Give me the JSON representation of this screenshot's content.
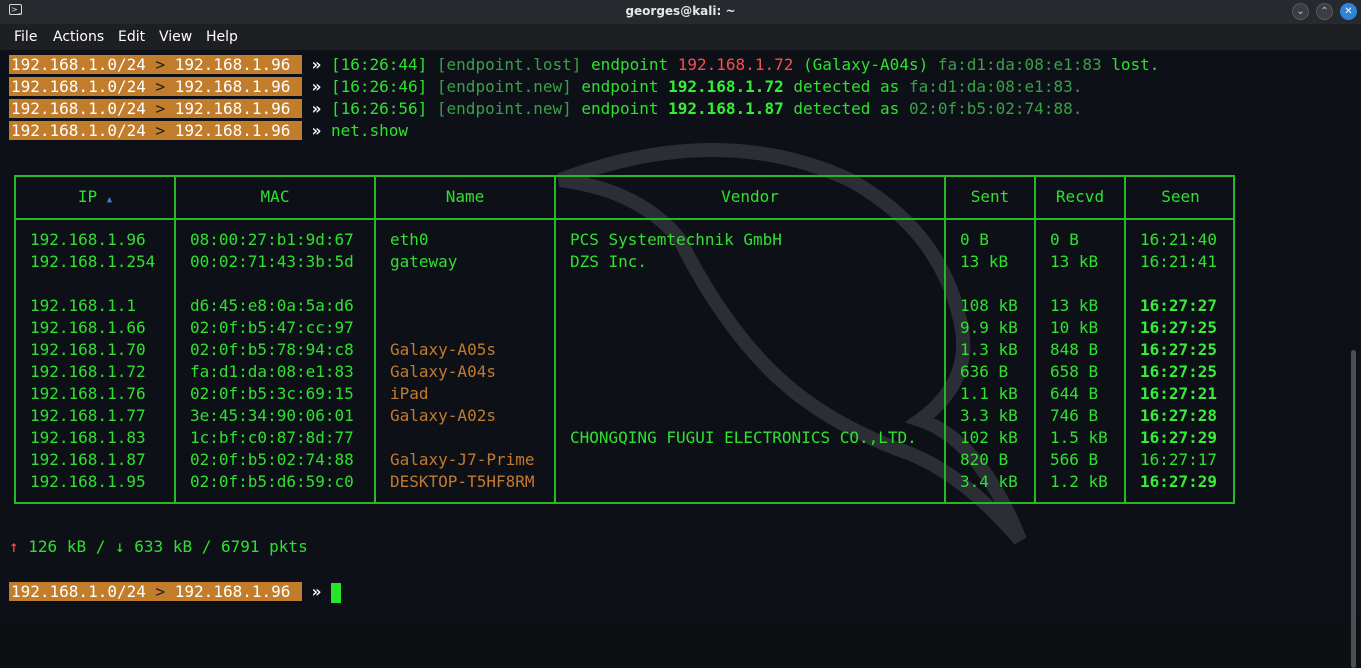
{
  "window": {
    "title": "georges@kali: ~",
    "buttons": [
      "⌄",
      "⌃",
      "✕"
    ]
  },
  "menu": [
    "File",
    "Actions",
    "Edit",
    "View",
    "Help"
  ],
  "prompt": {
    "subnet": "192.168.1.0/24",
    "sep": ">",
    "ip": "192.168.1.96",
    "arrow": "»"
  },
  "log": [
    {
      "time": "[16:26:44]",
      "tag": "[endpoint.lost]",
      "text1": "endpoint",
      "ip": "192.168.1.72",
      "extra": "(Galaxy-A04s)",
      "mac": "fa:d1:da:08:e1:83",
      "end": "lost."
    },
    {
      "time": "[16:26:46]",
      "tag": "[endpoint.new]",
      "text1": "endpoint",
      "ip": "192.168.1.72",
      "extra": "detected as",
      "mac": "fa:d1:da:08:e1:83",
      "end": "."
    },
    {
      "time": "[16:26:56]",
      "tag": "[endpoint.new]",
      "text1": "endpoint",
      "ip": "192.168.1.87",
      "extra": "detected as",
      "mac": "02:0f:b5:02:74:88",
      "end": "."
    }
  ],
  "command": "net.show",
  "table": {
    "headers": [
      "IP",
      "MAC",
      "Name",
      "Vendor",
      "Sent",
      "Recvd",
      "Seen"
    ],
    "sort_indicator": "▲",
    "rows": [
      {
        "ip": "192.168.1.96",
        "mac": "08:00:27:b1:9d:67",
        "name": "eth0",
        "vendor": "PCS Systemtechnik GmbH",
        "sent": "0 B",
        "recvd": "0 B",
        "seen": "16:21:40",
        "seen_bold": false,
        "name_color": "green"
      },
      {
        "ip": "192.168.1.254",
        "mac": "00:02:71:43:3b:5d",
        "name": "gateway",
        "vendor": "DZS Inc.",
        "sent": "13 kB",
        "recvd": "13 kB",
        "seen": "16:21:41",
        "seen_bold": false,
        "name_color": "green"
      },
      {
        "ip": "192.168.1.1",
        "mac": "d6:45:e8:0a:5a:d6",
        "name": "",
        "vendor": "",
        "sent": "108 kB",
        "recvd": "13 kB",
        "seen": "16:27:27",
        "seen_bold": true
      },
      {
        "ip": "192.168.1.66",
        "mac": "02:0f:b5:47:cc:97",
        "name": "",
        "vendor": "",
        "sent": "9.9 kB",
        "recvd": "10 kB",
        "seen": "16:27:25",
        "seen_bold": true
      },
      {
        "ip": "192.168.1.70",
        "mac": "02:0f:b5:78:94:c8",
        "name": "Galaxy-A05s",
        "vendor": "",
        "sent": "1.3 kB",
        "recvd": "848 B",
        "seen": "16:27:25",
        "seen_bold": true
      },
      {
        "ip": "192.168.1.72",
        "mac": "fa:d1:da:08:e1:83",
        "name": "Galaxy-A04s",
        "vendor": "",
        "sent": "636 B",
        "recvd": "658 B",
        "seen": "16:27:25",
        "seen_bold": true
      },
      {
        "ip": "192.168.1.76",
        "mac": "02:0f:b5:3c:69:15",
        "name": "iPad",
        "vendor": "",
        "sent": "1.1 kB",
        "recvd": "644 B",
        "seen": "16:27:21",
        "seen_bold": true
      },
      {
        "ip": "192.168.1.77",
        "mac": "3e:45:34:90:06:01",
        "name": "Galaxy-A02s",
        "vendor": "",
        "sent": "3.3 kB",
        "recvd": "746 B",
        "seen": "16:27:28",
        "seen_bold": true
      },
      {
        "ip": "192.168.1.83",
        "mac": "1c:bf:c0:87:8d:77",
        "name": "",
        "vendor": "CHONGQING FUGUI ELECTRONICS CO.,LTD.",
        "sent": "102 kB",
        "recvd": "1.5 kB",
        "seen": "16:27:29",
        "seen_bold": true
      },
      {
        "ip": "192.168.1.87",
        "mac": "02:0f:b5:02:74:88",
        "name": "Galaxy-J7-Prime",
        "vendor": "",
        "sent": "820 B",
        "recvd": "566 B",
        "seen": "16:27:17",
        "seen_bold": false
      },
      {
        "ip": "192.168.1.95",
        "mac": "02:0f:b5:d6:59:c0",
        "name": "DESKTOP-T5HF8RM",
        "vendor": "",
        "sent": "3.4 kB",
        "recvd": "1.2 kB",
        "seen": "16:27:29",
        "seen_bold": true
      }
    ]
  },
  "stats": {
    "up_arrow": "↑",
    "sent": "126 kB",
    "slash1": "/",
    "down_arrow": "↓",
    "recvd": "633 kB",
    "slash2": "/",
    "pkts": "6791 pkts"
  },
  "colors": {
    "prompt_bg": "#c17d2b",
    "green": "#2fe02f",
    "orange": "#c37a2e",
    "red": "#ff4b4b",
    "close_btn": "#2f83d6"
  }
}
